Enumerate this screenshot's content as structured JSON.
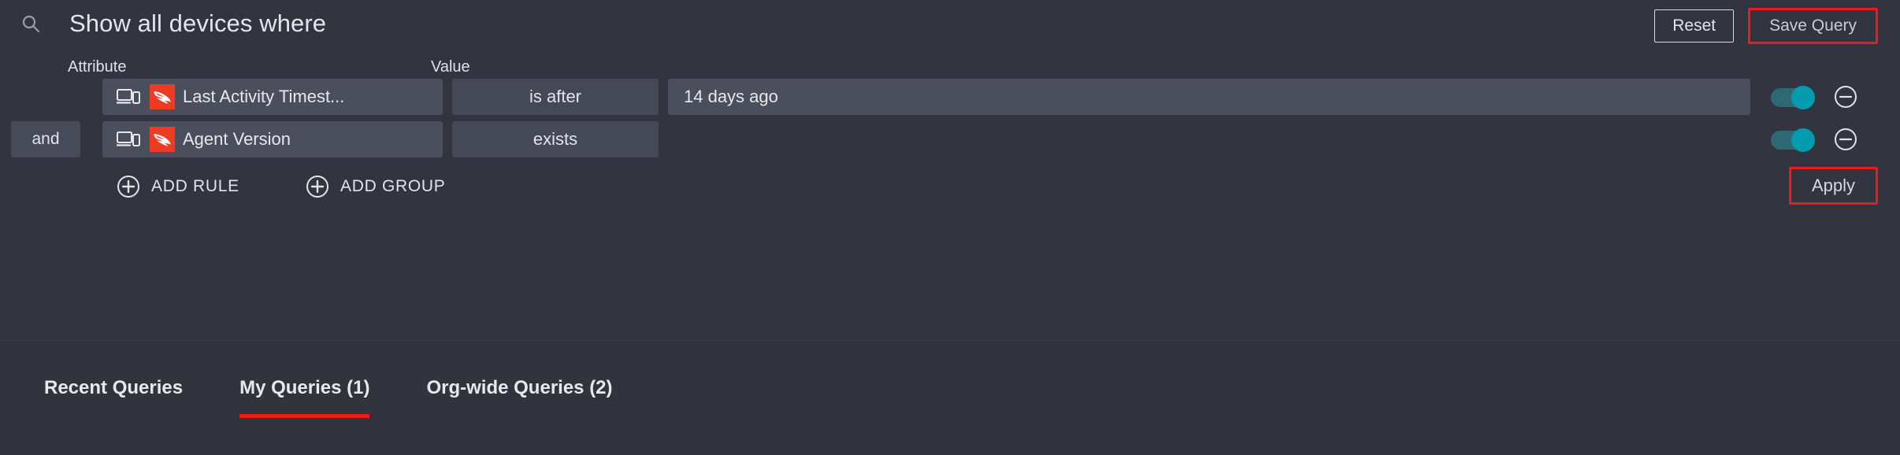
{
  "header": {
    "search_icon": "search-icon",
    "title": "Show all devices where",
    "reset_label": "Reset",
    "save_query_label": "Save Query"
  },
  "columns": {
    "attribute": "Attribute",
    "value": "Value"
  },
  "rules": [
    {
      "conjunction": "",
      "attribute_icon": "device-icon",
      "source_icon": "crowdstrike-falcon-logo",
      "attribute": "Last Activity Timest...",
      "operator": "is after",
      "value": "14 days ago",
      "enabled": true,
      "toggle_color": "#039bb0"
    },
    {
      "conjunction": "and",
      "attribute_icon": "device-icon",
      "source_icon": "crowdstrike-falcon-logo",
      "attribute": "Agent Version",
      "operator": "exists",
      "value": "",
      "enabled": true,
      "toggle_color": "#039bb0"
    }
  ],
  "actions": {
    "add_rule_label": "ADD RULE",
    "add_group_label": "ADD GROUP",
    "apply_label": "Apply"
  },
  "tabs": [
    {
      "label": "Recent Queries",
      "active": false
    },
    {
      "label": "My Queries (1)",
      "active": true
    },
    {
      "label": "Org-wide Queries (2)",
      "active": false
    }
  ],
  "colors": {
    "background": "#32353f",
    "field": "#4b4e5d",
    "operator_field": "#454856",
    "accent_red": "#ef1b1b",
    "falcon_red": "#ef3b24",
    "toggle_on": "#039bb0"
  }
}
